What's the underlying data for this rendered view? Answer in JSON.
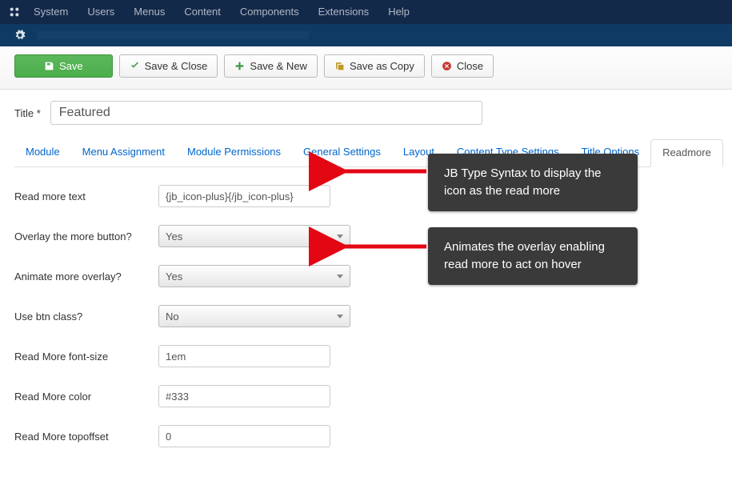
{
  "topnav": {
    "items": [
      "System",
      "Users",
      "Menus",
      "Content",
      "Components",
      "Extensions",
      "Help"
    ]
  },
  "toolbar": {
    "save": "Save",
    "save_close": "Save & Close",
    "save_new": "Save & New",
    "save_copy": "Save as Copy",
    "close": "Close"
  },
  "title": {
    "label": "Title",
    "required": "*",
    "value": "Featured"
  },
  "tabs": {
    "items": [
      {
        "label": "Module",
        "active": false
      },
      {
        "label": "Menu Assignment",
        "active": false
      },
      {
        "label": "Module Permissions",
        "active": false
      },
      {
        "label": "General Settings",
        "active": false
      },
      {
        "label": "Layout",
        "active": false
      },
      {
        "label": "Content Type Settings",
        "active": false
      },
      {
        "label": "Title Options",
        "active": false
      },
      {
        "label": "Readmore",
        "active": true
      }
    ]
  },
  "fields": {
    "read_more_text": {
      "label": "Read more text",
      "value": "{jb_icon-plus}{/jb_icon-plus}"
    },
    "overlay_more": {
      "label": "Overlay the more button?",
      "value": "Yes"
    },
    "animate_overlay": {
      "label": "Animate more overlay?",
      "value": "Yes"
    },
    "use_btn_class": {
      "label": "Use btn class?",
      "value": "No"
    },
    "font_size": {
      "label": "Read More font-size",
      "value": "1em"
    },
    "color": {
      "label": "Read More color",
      "value": "#333"
    },
    "topoffset": {
      "label": "Read More topoffset",
      "value": "0"
    }
  },
  "callouts": {
    "c1": "JB Type Syntax to display the icon as the read more",
    "c2": "Animates the overlay enabling read more to act on hover"
  }
}
